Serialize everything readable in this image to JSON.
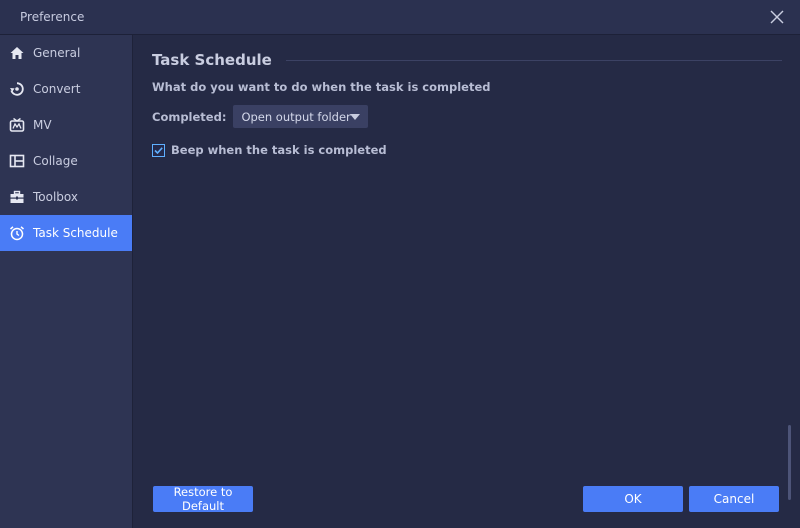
{
  "window": {
    "title": "Preference"
  },
  "sidebar": {
    "items": [
      {
        "label": "General",
        "icon": "home-icon",
        "active": false
      },
      {
        "label": "Convert",
        "icon": "convert-icon",
        "active": false
      },
      {
        "label": "MV",
        "icon": "mv-icon",
        "active": false
      },
      {
        "label": "Collage",
        "icon": "collage-icon",
        "active": false
      },
      {
        "label": "Toolbox",
        "icon": "toolbox-icon",
        "active": false
      },
      {
        "label": "Task Schedule",
        "icon": "alarm-clock-icon",
        "active": true
      }
    ]
  },
  "main": {
    "section_title": "Task Schedule",
    "question": "What do you want to do when the task is completed",
    "completed_label": "Completed:",
    "completed_value": "Open output folder",
    "beep_label": "Beep when the task is completed",
    "beep_checked": true
  },
  "footer": {
    "restore_label": "Restore to Default",
    "ok_label": "OK",
    "cancel_label": "Cancel"
  },
  "colors": {
    "accent": "#4a7cf6",
    "background": "#252a45",
    "sidebar": "#2e3453"
  }
}
